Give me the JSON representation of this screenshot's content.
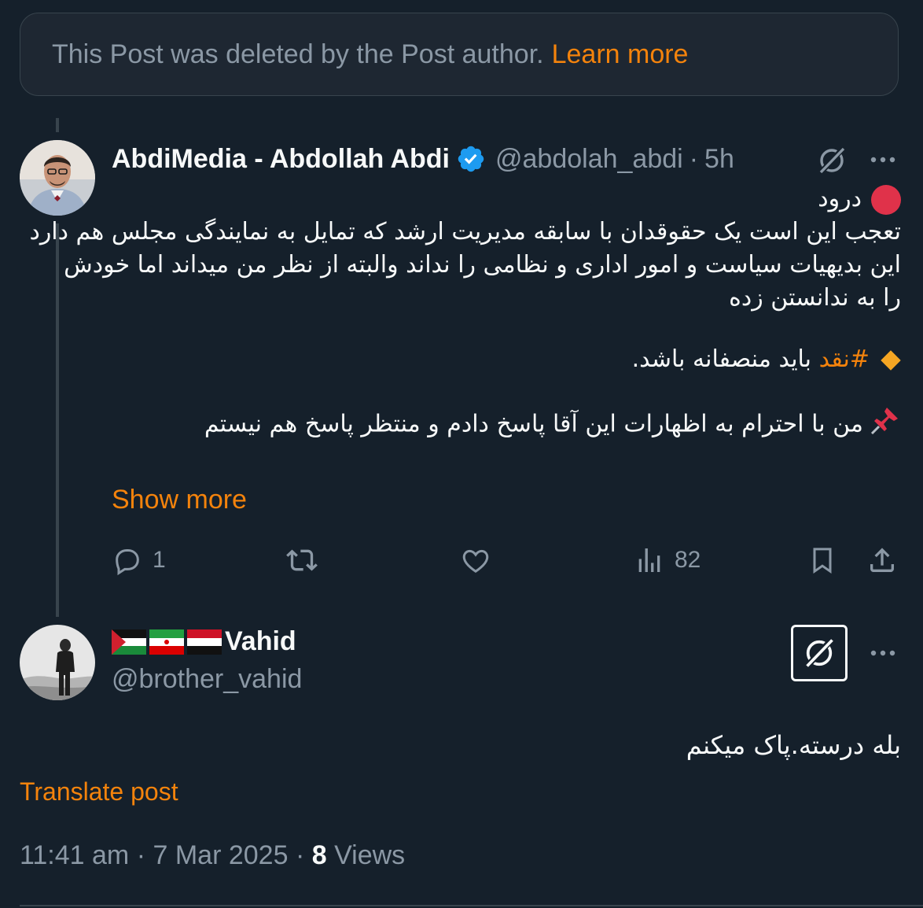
{
  "deleted_notice": {
    "text": "This Post was deleted by the Post author.",
    "link": "Learn more"
  },
  "post": {
    "author_name": "AbdiMedia - Abdollah Abdi",
    "handle": "@abdolah_abdi",
    "separator": "·",
    "time": "5h",
    "lines": {
      "l1": "درود",
      "l2": "تعجب این است یک حقوقدان با سابقه مدیریت ارشد که تمایل به نمایندگی مجلس هم دارد",
      "l3": "این بدیهیات سیاست و امور اداری و نظامی را نداند والبته از نظر من میداند اما خودش",
      "l4": "را به ندانستن زده",
      "l5_hashtag": "#نقد",
      "l5_rest": " باید منصفانه باشد.",
      "l6": "من با احترام به اظهارات این آقا پاسخ دادم و منتظر پاسخ هم نیستم"
    },
    "show_more": "Show more",
    "actions": {
      "reply_count": "1",
      "views_count": "82"
    }
  },
  "reply": {
    "author_name": "Vahid",
    "handle": "@brother_vahid",
    "text": "بله درسته.پاک میکنم",
    "translate": "Translate post",
    "time": "11:41 am",
    "date": "7 Mar 2025",
    "separator": "·",
    "views_count": "8",
    "views_label": "Views"
  },
  "icons": {
    "verified": "verified-badge-icon",
    "grok": "grok-icon",
    "more": "more-icon",
    "reply": "reply-icon",
    "repost": "repost-icon",
    "like": "like-icon",
    "views": "views-icon",
    "bookmark": "bookmark-icon",
    "share": "share-icon"
  },
  "colors": {
    "background": "#15202b",
    "accent": "#f4830c",
    "muted": "#8b98a5",
    "verified": "#1d9bf0"
  }
}
